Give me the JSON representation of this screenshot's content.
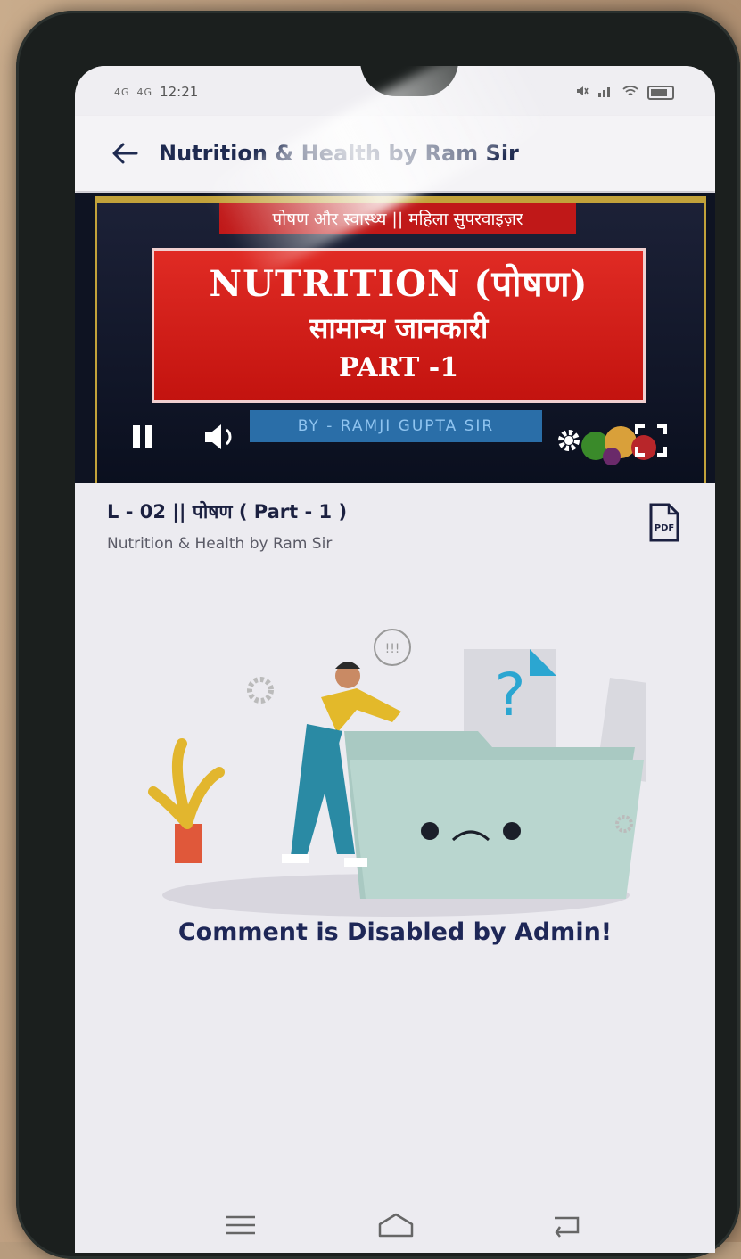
{
  "status_bar": {
    "time": "12:21",
    "signal_1": "4G",
    "signal_2": "4G",
    "colors": {
      "icons": "#666666"
    }
  },
  "app_bar": {
    "back_icon": "arrow-left-icon",
    "title": "Nutrition & Health by Ram Sir"
  },
  "video": {
    "banner_text": "पोषण और स्वास्थ्य || महिला सुपरवाइज़र",
    "card_line1": "NUTRITION (पोषण)",
    "card_line2": "सामान्य जानकारी",
    "card_line3": "PART -1",
    "author_label": "BY - RAMJI GUPTA SIR",
    "controls": {
      "pause_icon": "pause-icon",
      "volume_icon": "volume-icon",
      "settings_icon": "gear-icon",
      "fullscreen_icon": "fullscreen-icon"
    },
    "colors": {
      "card_red": "#d81e19",
      "frame_gold": "#c2a23a",
      "label_blue": "#2a6ea8"
    }
  },
  "lesson": {
    "title": "L - 02 || पोषण ( Part - 1 )",
    "course": "Nutrition & Health by Ram Sir",
    "pdf_icon": "pdf-icon"
  },
  "comments": {
    "message": "Comment is Disabled by Admin!",
    "illustration": "empty-folder-illustration",
    "colors": {
      "message": "#1e2757",
      "folder": "#a9c9c2"
    }
  },
  "nav_bar": {
    "menu_icon": "menu-icon",
    "home_icon": "home-icon",
    "back_icon": "back-icon"
  }
}
